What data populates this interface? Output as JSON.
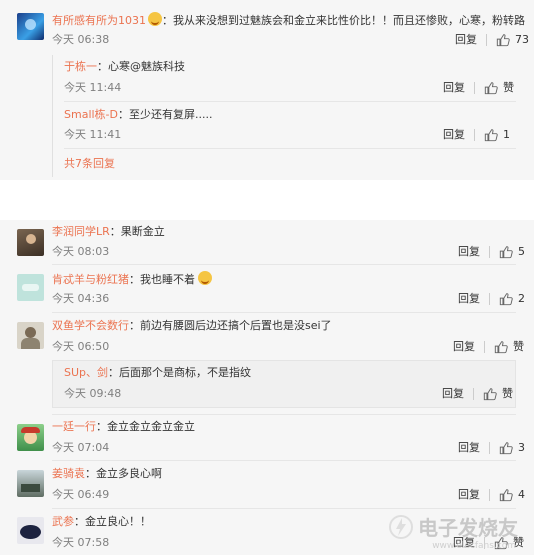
{
  "colors": {
    "username": "#eb7350",
    "time": "#808080",
    "panel": "#f6f6f6"
  },
  "icons": {
    "like": "thumb-up-icon",
    "emoji_sob": "crying-emoji-icon"
  },
  "top_comment": {
    "username": "有所感有所为1031",
    "text": "：我从来没想到过魅族会和金立来比性价比！！而且还惨败，心寒，粉转路",
    "time": "今天 06:38",
    "reply": "回复",
    "likes": "73",
    "replies": [
      {
        "username": "于栋一",
        "text": "：心寒@魅族科技",
        "time": "今天 11:44",
        "reply": "回复",
        "likes": "赞"
      },
      {
        "username": "Small栋-D",
        "text": "：至少还有复屏.....",
        "time": "今天 11:41",
        "reply": "回复",
        "likes": "1"
      }
    ],
    "more": "共7条回复"
  },
  "comments": [
    {
      "username": "李润同学LR",
      "text": "：果断金立",
      "time": "今天 08:03",
      "reply": "回复",
      "likes": "5"
    },
    {
      "username": "肯忒羊与粉红猪",
      "text": "：我也睡不着",
      "time": "今天 04:36",
      "reply": "回复",
      "likes": "2"
    },
    {
      "username": "双鱼学不会数行",
      "text": "：前边有腰圆后边还搞个后置也是没sei了",
      "time": "今天 06:50",
      "reply": "回复",
      "likes": "赞",
      "sub": {
        "username": "SUp、剑",
        "text": "：后面那个是商标，不是指纹",
        "time": "今天 09:48",
        "reply": "回复",
        "likes": "赞"
      }
    },
    {
      "username": "一廷一行",
      "text": "：金立金立金立金立",
      "time": "今天 07:04",
      "reply": "回复",
      "likes": "3"
    },
    {
      "username": "姜骑袁",
      "text": "：金立多良心啊",
      "time": "今天 06:49",
      "reply": "回复",
      "likes": "4"
    },
    {
      "username": "武参",
      "text": "：金立良心！！",
      "time": "今天 07:58",
      "reply": "回复",
      "likes": "赞"
    }
  ],
  "watermark": {
    "brand": "电子发烧友",
    "url": "www.elecfans.com"
  }
}
